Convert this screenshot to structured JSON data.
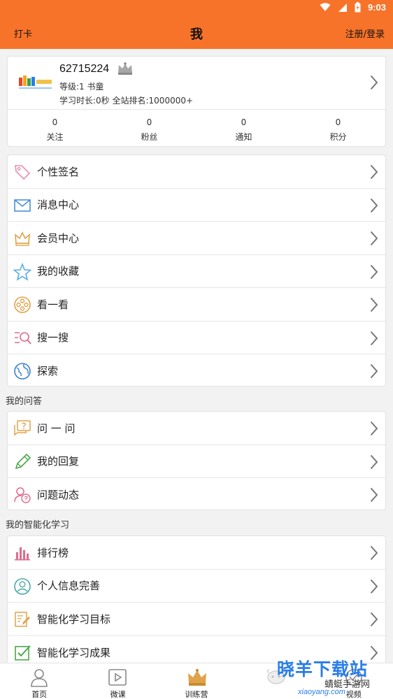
{
  "status_bar": {
    "time": "9:03"
  },
  "header": {
    "checkin": "打卡",
    "title": "我",
    "register_login": "注册/登录"
  },
  "profile": {
    "user_id": "62715224",
    "level": "等级:1 书童",
    "stats": "学习时长:0秒  全站排名:1000000+",
    "counters": [
      {
        "value": "0",
        "label": "关注"
      },
      {
        "value": "0",
        "label": "粉丝"
      },
      {
        "value": "0",
        "label": "通知"
      },
      {
        "value": "0",
        "label": "积分"
      }
    ]
  },
  "menu_main": [
    {
      "label": "个性签名",
      "icon": "tag-icon"
    },
    {
      "label": "消息中心",
      "icon": "mail-icon"
    },
    {
      "label": "会员中心",
      "icon": "crown-icon"
    },
    {
      "label": "我的收藏",
      "icon": "star-icon"
    },
    {
      "label": "看一看",
      "icon": "film-reel-icon"
    },
    {
      "label": "搜一搜",
      "icon": "search-list-icon"
    },
    {
      "label": "探索",
      "icon": "globe-icon"
    }
  ],
  "section_qa": {
    "title": "我的问答",
    "items": [
      {
        "label": "问 一 问",
        "icon": "question-bubble-icon"
      },
      {
        "label": "我的回复",
        "icon": "pencil-icon"
      },
      {
        "label": "问题动态",
        "icon": "user-question-icon"
      }
    ]
  },
  "section_learning": {
    "title": "我的智能化学习",
    "items": [
      {
        "label": "排行榜",
        "icon": "bar-chart-icon"
      },
      {
        "label": "个人信息完善",
        "icon": "user-circle-icon"
      },
      {
        "label": "智能化学习目标",
        "icon": "edit-doc-icon"
      },
      {
        "label": "智能化学习成果",
        "icon": "check-box-icon"
      }
    ]
  },
  "tabs": [
    {
      "label": "首页",
      "icon": "person-icon"
    },
    {
      "label": "微课",
      "icon": "play-icon"
    },
    {
      "label": "训练营",
      "icon": "crown-icon"
    },
    {
      "label": "",
      "icon": "sheep-icon"
    },
    {
      "label": "视频",
      "icon": "video-icon"
    }
  ],
  "watermark": {
    "brand": "晓羊下载站",
    "sub": "蜻蜓手游网",
    "url": "xiaoyang.com"
  },
  "colors": {
    "accent": "#f77329",
    "watermark": "#2a7ee8"
  }
}
